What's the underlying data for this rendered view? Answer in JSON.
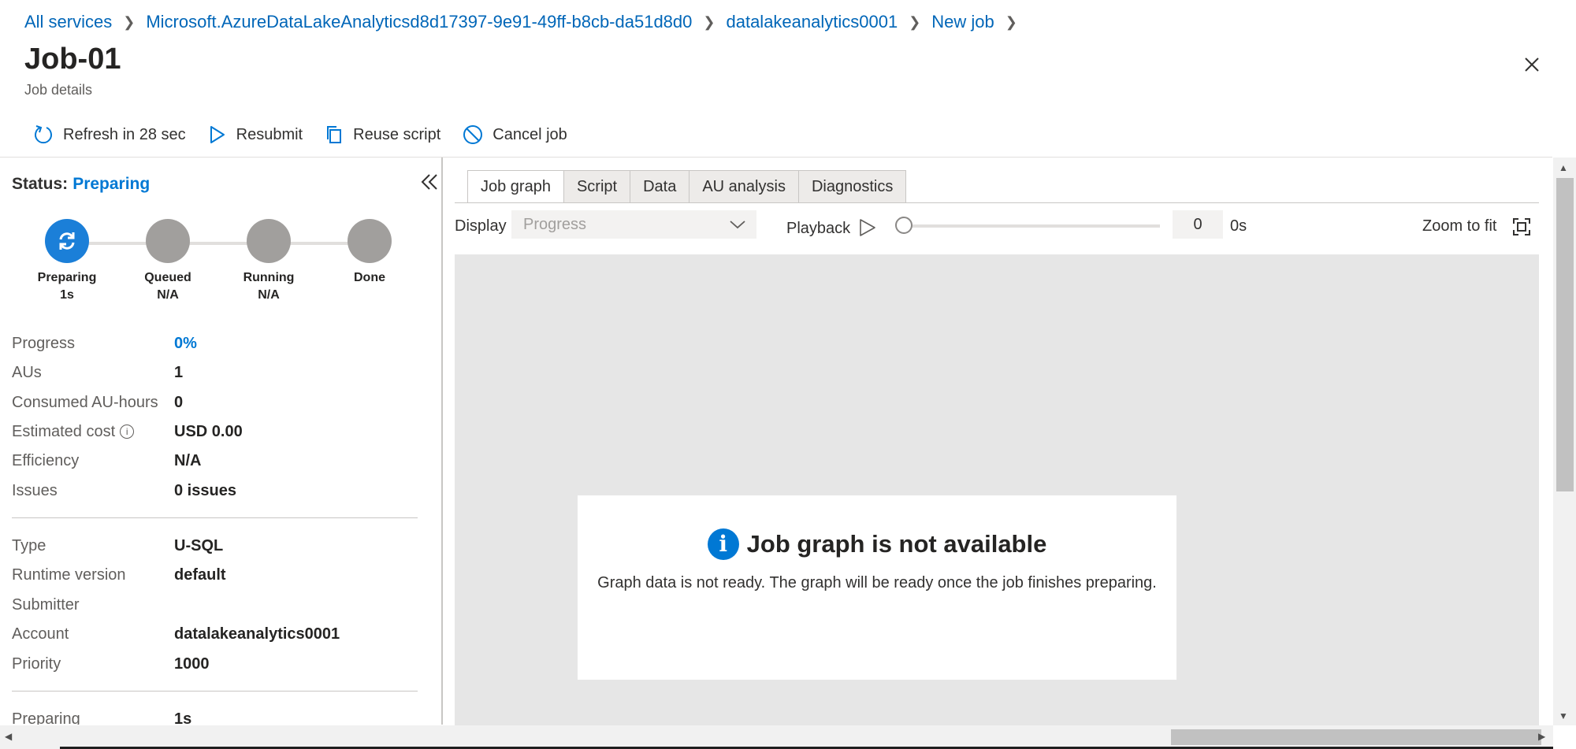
{
  "breadcrumb": {
    "items": [
      "All services",
      "Microsoft.AzureDataLakeAnalyticsd8d17397-9e91-49ff-b8cb-da51d8d0",
      "datalakeanalytics0001",
      "New job"
    ]
  },
  "header": {
    "title": "Job-01",
    "subtitle": "Job details"
  },
  "toolbar": {
    "refresh_label": "Refresh in 28 sec",
    "resubmit_label": "Resubmit",
    "reuse_label": "Reuse script",
    "cancel_label": "Cancel job"
  },
  "status": {
    "label": "Status:",
    "value": "Preparing"
  },
  "steps": [
    {
      "name": "Preparing",
      "time": "1s",
      "active": true
    },
    {
      "name": "Queued",
      "time": "N/A",
      "active": false
    },
    {
      "name": "Running",
      "time": "N/A",
      "active": false
    },
    {
      "name": "Done",
      "time": "",
      "active": false
    }
  ],
  "details": {
    "progress": {
      "key": "Progress",
      "value": "0%"
    },
    "aus": {
      "key": "AUs",
      "value": "1"
    },
    "consumed": {
      "key": "Consumed AU-hours",
      "value": "0"
    },
    "cost": {
      "key": "Estimated cost",
      "value": "USD 0.00"
    },
    "efficiency": {
      "key": "Efficiency",
      "value": "N/A"
    },
    "issues": {
      "key": "Issues",
      "value": "0 issues"
    },
    "type": {
      "key": "Type",
      "value": "U-SQL"
    },
    "runtime": {
      "key": "Runtime version",
      "value": "default"
    },
    "submitter": {
      "key": "Submitter",
      "value": ""
    },
    "account": {
      "key": "Account",
      "value": "datalakeanalytics0001"
    },
    "priority": {
      "key": "Priority",
      "value": "1000"
    },
    "preparing": {
      "key": "Preparing",
      "value": "1s"
    }
  },
  "tabs": [
    "Job graph",
    "Script",
    "Data",
    "AU analysis",
    "Diagnostics"
  ],
  "controls": {
    "display_label": "Display",
    "display_value": "Progress",
    "playback_label": "Playback",
    "frame_value": "0",
    "time_value": "0s",
    "zoom_label": "Zoom to fit",
    "playback_position": 0
  },
  "message": {
    "title": "Job graph is not available",
    "body": "Graph data is not ready. The graph will be ready once the job finishes preparing."
  },
  "colors": {
    "accent": "#0078d4",
    "active_step": "#1b7fd8",
    "inactive_step": "#a19f9d"
  }
}
